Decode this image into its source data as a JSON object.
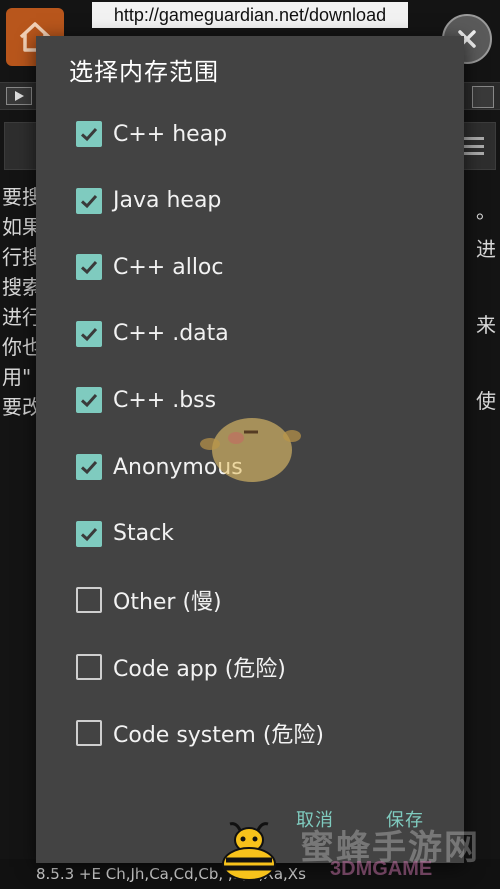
{
  "background": {
    "url": "http://gameguardian.net/download",
    "text_left": "要搜\n如果\n行搜\n搜索\n进行\n你也\n用\"\n要改",
    "text_right": "。\n进\n\n来\n\n使",
    "status_text": "8.5.3  +E Ch,Jh,Ca,Cd,Cb,  ,S,O,Xa,Xs"
  },
  "dialog": {
    "title": "选择内存范围",
    "options": [
      {
        "label": "C++ heap",
        "checked": true
      },
      {
        "label": "Java heap",
        "checked": true
      },
      {
        "label": "C++ alloc",
        "checked": true
      },
      {
        "label": "C++ .data",
        "checked": true
      },
      {
        "label": "C++ .bss",
        "checked": true
      },
      {
        "label": "Anonymous",
        "checked": true
      },
      {
        "label": "Stack",
        "checked": true
      },
      {
        "label": "Other (慢)",
        "checked": false
      },
      {
        "label": "Code app (危险)",
        "checked": false
      },
      {
        "label": "Code system (危险)",
        "checked": false
      }
    ],
    "cancel_label": "取消",
    "save_label": "保存"
  },
  "watermark": {
    "cn": "蜜蜂手游网",
    "en": "3DMGAME"
  },
  "colors": {
    "accent": "#7fcbbf",
    "dialog_bg": "#434343",
    "home_button": "#b8561c"
  }
}
